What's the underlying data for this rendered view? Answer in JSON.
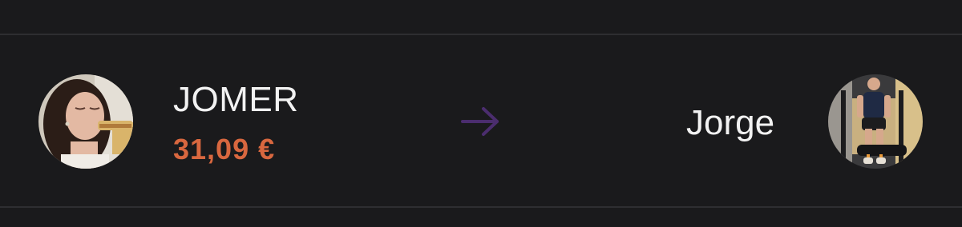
{
  "transfer": {
    "sender": {
      "name": "JOMER",
      "amount": "31,09 €"
    },
    "recipient": {
      "name": "Jorge"
    },
    "arrow_icon": "arrow-right-icon",
    "colors": {
      "background": "#1a1a1c",
      "amount": "#d8673f",
      "arrow": "#4b2d6e",
      "text": "#f2f2f2"
    }
  }
}
